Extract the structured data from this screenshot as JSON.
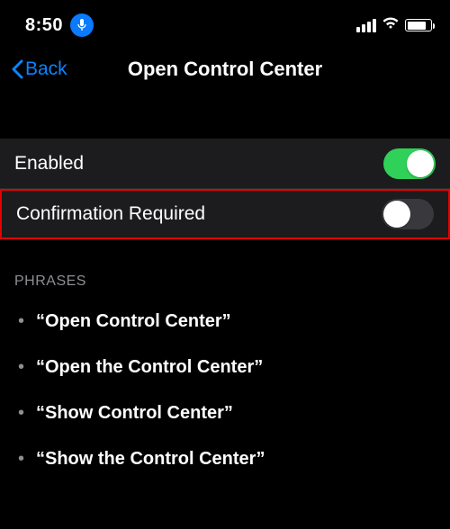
{
  "status": {
    "time": "8:50"
  },
  "nav": {
    "back_label": "Back",
    "title": "Open Control Center"
  },
  "settings": {
    "enabled": {
      "label": "Enabled",
      "on": true
    },
    "confirmation": {
      "label": "Confirmation Required",
      "on": false
    }
  },
  "phrases": {
    "header": "PHRASES",
    "items": [
      "“Open Control Center”",
      "“Open the Control Center”",
      "“Show Control Center”",
      "“Show the Control Center”"
    ]
  }
}
